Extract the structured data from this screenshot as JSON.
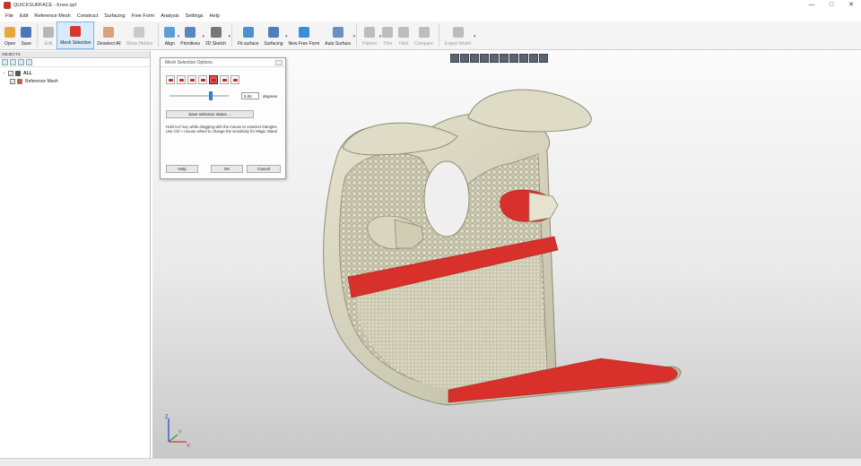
{
  "window": {
    "title": "QUICKSURFACE - Knee.qsf",
    "controls": [
      "—",
      "□",
      "✕"
    ]
  },
  "menu": [
    "File",
    "Edit",
    "Reference Mesh",
    "Construct",
    "Surfacing",
    "Free Form",
    "Analysis",
    "Settings",
    "Help"
  ],
  "toolbar": [
    {
      "label": "Open",
      "icon": "folder-icon",
      "color": "#e8a93a",
      "state": "normal"
    },
    {
      "label": "Save",
      "icon": "save-icon",
      "color": "#4a78b8",
      "state": "normal"
    },
    {
      "label": "Edit",
      "icon": "edit-icon",
      "color": "#b7b7b7",
      "state": "disabled"
    },
    {
      "label": "Mesh Selection",
      "icon": "mesh-selection-icon",
      "color": "#d9362b",
      "state": "active"
    },
    {
      "label": "Deselect All",
      "icon": "deselect-all-icon",
      "color": "#d9a27a",
      "state": "normal"
    },
    {
      "label": "Show Hidden",
      "icon": "show-hidden-icon",
      "color": "#c9c9c9",
      "state": "disabled"
    },
    {
      "label": "Align",
      "icon": "align-icon",
      "color": "#5aa0d8",
      "state": "normal",
      "dropdown": true
    },
    {
      "label": "Primitives",
      "icon": "primitives-icon",
      "color": "#5a86c0",
      "state": "normal",
      "dropdown": true
    },
    {
      "label": "2D Sketch",
      "icon": "sketch-icon",
      "color": "#777",
      "state": "normal",
      "dropdown": true
    },
    {
      "label": "Fit surface",
      "icon": "fit-surface-icon",
      "color": "#4e8fd0",
      "state": "normal"
    },
    {
      "label": "Surfacing",
      "icon": "surfacing-icon",
      "color": "#4e7fb8",
      "state": "normal",
      "dropdown": true
    },
    {
      "label": "New Free Form",
      "icon": "free-form-icon",
      "color": "#3c8ed8",
      "state": "normal"
    },
    {
      "label": "Auto Surface",
      "icon": "auto-surface-icon",
      "color": "#6a8fc0",
      "state": "normal",
      "dropdown": true
    },
    {
      "label": "Pattern",
      "icon": "pattern-icon",
      "color": "#bdbdbd",
      "state": "disabled",
      "dropdown": true
    },
    {
      "label": "Trim",
      "icon": "trim-icon",
      "color": "#bdbdbd",
      "state": "disabled"
    },
    {
      "label": "Fillet",
      "icon": "fillet-icon",
      "color": "#bdbdbd",
      "state": "disabled"
    },
    {
      "label": "Compare",
      "icon": "compare-icon",
      "color": "#bdbdbd",
      "state": "disabled"
    },
    {
      "label": "Export Model",
      "icon": "export-icon",
      "color": "#bdbdbd",
      "state": "disabled",
      "dropdown": true
    }
  ],
  "objects_panel": {
    "header": "OBJECTS",
    "tree": [
      {
        "label": "ALL",
        "checked": true,
        "expand": "−",
        "icon": "folder-icon"
      },
      {
        "label": "Reference Mesh",
        "checked": true,
        "icon": "mesh-icon"
      }
    ]
  },
  "dialog": {
    "title": "Mesh Selection Options",
    "degree_value": "5.84",
    "degree_unit": "degrees",
    "save_button": "Save selection status ...",
    "hint": "Hold ALT key while dragging with the mouse to unselect triangles. Use Ctrl + mouse wheel to change the sensitivity for Magic Wand",
    "help_button": "Help",
    "ok_button": "OK",
    "cancel_button": "Cancel"
  },
  "view_tool_icons": [
    "zoom-fit-icon",
    "view-icon",
    "view-front-icon",
    "view-top-icon",
    "view-left-icon",
    "view-right-icon",
    "view-iso-icon",
    "view-back-icon",
    "render-icon",
    "grid-icon"
  ],
  "axis": {
    "z": "Z",
    "x": "X",
    "y": "Y"
  },
  "colors": {
    "mesh": "#cfcdb4",
    "selection": "#d8302a",
    "accent": "#2f7fd2"
  }
}
